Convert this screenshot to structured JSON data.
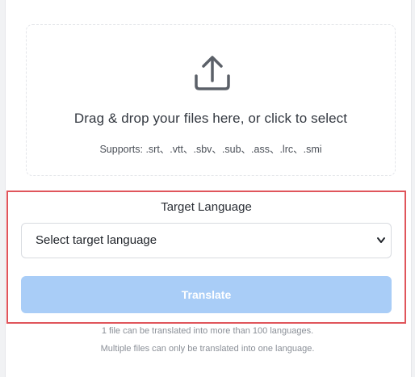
{
  "upload": {
    "icon": "upload-icon",
    "title": "Drag & drop your files here, or click to select",
    "supports": "Supports: .srt、.vtt、.sbv、.sub、.ass、.lrc、.smi"
  },
  "target": {
    "label": "Target Language",
    "select_value": "Select target language",
    "button_label": "Translate"
  },
  "info": {
    "line1": "1 file can be translated into more than 100 languages.",
    "line2": "Multiple files can only be translated into one language."
  },
  "colors": {
    "highlight_border": "#e0555b",
    "button_disabled": "#a9cdf7"
  }
}
